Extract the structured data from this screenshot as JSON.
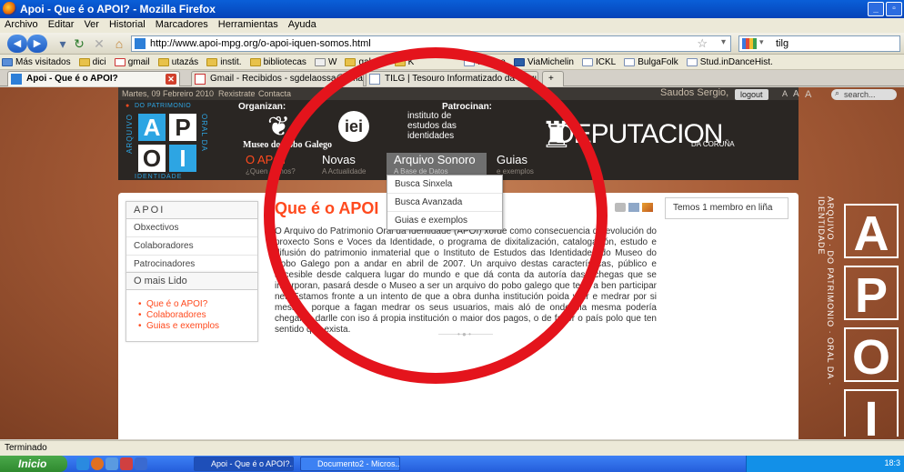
{
  "browser": {
    "title": "Apoi - Que é o APOI? - Mozilla Firefox",
    "menu": [
      "Archivo",
      "Editar",
      "Ver",
      "Historial",
      "Marcadores",
      "Herramientas",
      "Ayuda"
    ],
    "url": "http://www.apoi-mpg.org/o-apoi-iquen-somos.html",
    "search_value": "tilg",
    "bookmarks": [
      "Más visitados",
      "dici",
      "gmail",
      "utazás",
      "instit.",
      "bibliotecas",
      "W",
      "galego",
      "K",
      "Folque",
      "ViaMichelin",
      "ICKL",
      "BulgaFolk",
      "Stud.inDanceHist."
    ],
    "tabs": [
      {
        "label": "Apoi - Que é o APOI?",
        "active": true
      },
      {
        "label": "Gmail - Recibidos - sgdelaossa@gmail.com",
        "active": false
      },
      {
        "label": "TILG | Tesouro Informatizado da Lingua...",
        "active": false
      }
    ],
    "status": "Terminado"
  },
  "site": {
    "top": {
      "date": "Martes, 09 Febreiro 2010",
      "register": "Rexistrate",
      "contact": "Contacta",
      "greeting": "Saudos Sergio,",
      "logout": "logout",
      "font_sizes": [
        "A",
        "A",
        "A"
      ],
      "search_placeholder": "search..."
    },
    "logo": {
      "letters": [
        "A",
        "P",
        "O",
        "I"
      ],
      "left_text": "ARQUIVO",
      "top_text": "DO PATRIMONIO",
      "right_text": "ORAL DA",
      "bottom_text": "IDENTIDADE"
    },
    "organizan": "Organizan:",
    "patrocinan": "Patrocinan:",
    "museo": "Museo do Pobo Galego",
    "instituto": [
      "instituto de",
      "estudos das",
      "identidades"
    ],
    "deputacion": "DEPUTACION",
    "deputacion_sub": "DA CORUÑA",
    "menu": [
      {
        "label": "O APOI",
        "sub": "¿Quen somos?"
      },
      {
        "label": "Novas",
        "sub": "A Actualidade"
      },
      {
        "label": "Arquivo Sonoro",
        "sub": "A Base de Datos"
      },
      {
        "label": "Guias",
        "sub": "e exemplos"
      }
    ],
    "dropdown": [
      "Busca Sinxela",
      "Busca Avanzada",
      "Guias e exemplos"
    ],
    "sidebar": {
      "apoi_title": "APOI",
      "apoi_items": [
        "Obxectivos",
        "Colaboradores",
        "Patrocinadores"
      ],
      "popular_title": "O mais Lido",
      "popular_items": [
        "Que é o APOI?",
        "Colaboradores",
        "Guias e exemplos"
      ]
    },
    "heading": "Que é o APOI",
    "body": "O Arquivo do Patrimonio Oral da Identidade (APOI) xorde como consecuencia da evolución do proxecto Sons e Voces da Identidade, o programa de dixitalización, catalogación, estudo e difusión do patrimonio inmaterial que o Instituto de Estudos das Identidades do Museo do Pobo Galego pon a andar en abril de 2007. Un arquivo destas características, público e accesible desde calquera lugar do mundo e que dá conta da autoría das achegas que se incorporan, pasará desde o Museo a ser un arquivo do pobo galego que teña a ben participar nel. Estamos fronte a un intento de que a obra dunha institución poida vivir e medrar por si mesma, porque a fagan medrar os seus usuarios, mais aló de onde ela mesma podería chegar, e darlle con iso á propia institución o maior dos pagos, o de facer o país polo que ten sentido que exista.",
    "online": "Temos 1 membro en liña",
    "side_vertical": "ARQUIVO · DO PATRIMONIO · ORAL DA · IDENTIDADE"
  },
  "taskbar": {
    "start": "Inicio",
    "tasks": [
      "Apoi - Que é o APOI?...",
      "Documento2 - Micros..."
    ],
    "clock": "18:3"
  },
  "colors": {
    "accent": "#ff4a1e",
    "annotation": "#e4141c",
    "logo_blue": "#2da5e3"
  }
}
